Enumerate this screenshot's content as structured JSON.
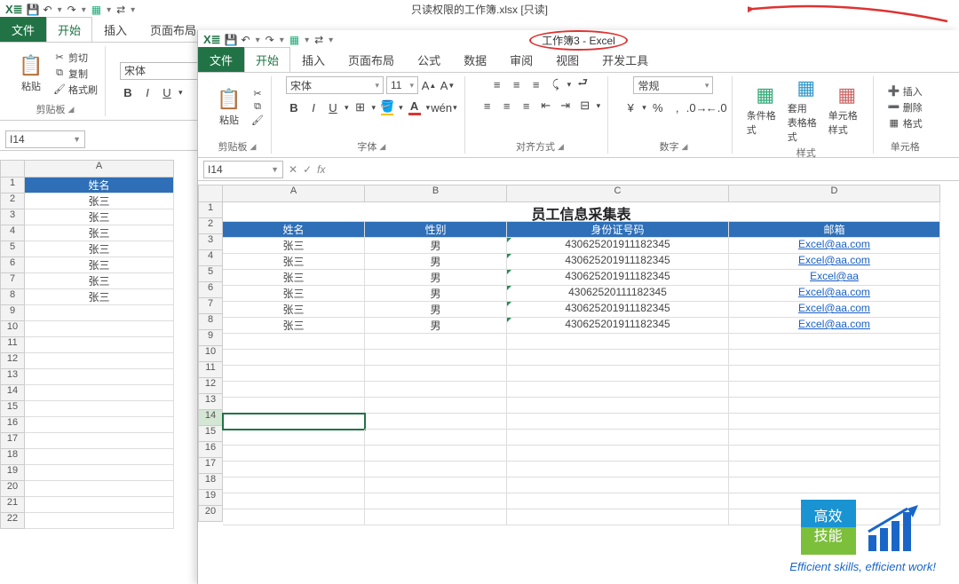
{
  "back": {
    "title": "只读权限的工作簿.xlsx  [只读]",
    "tabs": {
      "file": "文件",
      "home": "开始",
      "insert": "插入",
      "layout": "页面布局"
    },
    "clipboard": {
      "paste": "粘贴",
      "cut": "剪切",
      "copy": "复制",
      "painter": "格式刷",
      "label": "剪贴板"
    },
    "font": {
      "name": "宋体"
    },
    "nameBox": "I14",
    "colA": "A",
    "header": "姓名",
    "rows": [
      "张三",
      "张三",
      "张三",
      "张三",
      "张三",
      "张三",
      "张三"
    ]
  },
  "front": {
    "title": "工作簿3 - Excel",
    "tabs": {
      "file": "文件",
      "home": "开始",
      "insert": "插入",
      "layout": "页面布局",
      "formula": "公式",
      "data": "数据",
      "review": "审阅",
      "view": "视图",
      "dev": "开发工具"
    },
    "clipboard": {
      "paste": "粘贴",
      "label": "剪贴板"
    },
    "font": {
      "name": "宋体",
      "size": "11",
      "label": "字体"
    },
    "align": {
      "label": "对齐方式"
    },
    "number": {
      "style": "常规",
      "label": "数字"
    },
    "styles": {
      "cond": "条件格式",
      "table": "套用\n表格格式",
      "cell": "单元格样式",
      "label": "样式"
    },
    "cells": {
      "insert": "插入",
      "delete": "删除",
      "format": "格式",
      "label": "单元格"
    },
    "nameBox": "I14",
    "cols": [
      "A",
      "B",
      "C",
      "D"
    ],
    "titleRow": "员工信息采集表",
    "headers": [
      "姓名",
      "性别",
      "身份证号码",
      "邮箱"
    ],
    "data": [
      {
        "name": "张三",
        "sex": "男",
        "id": "430625201911182345",
        "mail": "Excel@aa.com"
      },
      {
        "name": "张三",
        "sex": "男",
        "id": "430625201911182345",
        "mail": "Excel@aa.com"
      },
      {
        "name": "张三",
        "sex": "男",
        "id": "430625201911182345",
        "mail": "Excel@aa"
      },
      {
        "name": "张三",
        "sex": "男",
        "id": "43062520111182345",
        "mail": "Excel@aa.com"
      },
      {
        "name": "张三",
        "sex": "男",
        "id": "430625201911182345",
        "mail": "Excel@aa.com"
      },
      {
        "name": "张三",
        "sex": "男",
        "id": "430625201911182345",
        "mail": "Excel@aa.com"
      }
    ]
  },
  "logo": {
    "l1": "高效",
    "l2": "技能",
    "tag": "Efficient skills, efficient work!"
  }
}
